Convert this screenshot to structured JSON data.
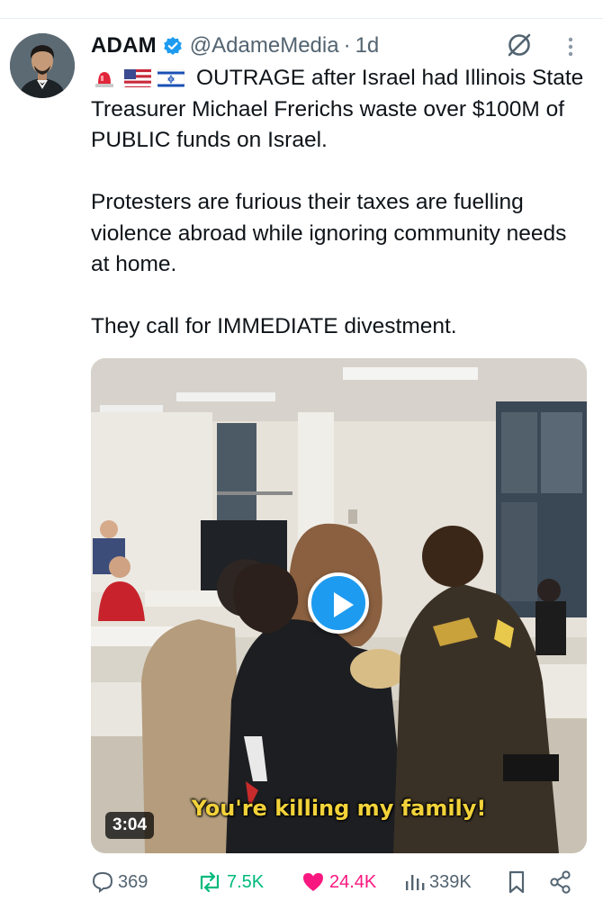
{
  "tweet": {
    "author_name": "ADAM",
    "handle": "@AdameMedia",
    "separator": "·",
    "time": "1d",
    "headline": "OUTRAGE after Israel had Illinois State Treasurer Michael Frerichs waste over $100M of PUBLIC funds on Israel.",
    "paragraph_2": "Protesters are furious their taxes are fuelling violence abroad while ignoring community needs at home.",
    "paragraph_3": "They call for IMMEDIATE divestment.",
    "flag_icons": [
      "siren-emoji-icon",
      "us-flag-icon",
      "israel-flag-icon"
    ]
  },
  "video": {
    "caption": "You're killing my family!",
    "duration": "3:04"
  },
  "actions": {
    "replies": "369",
    "reposts": "7.5K",
    "likes": "24.4K",
    "views": "339K"
  },
  "colors": {
    "accent": "#1d9bf0",
    "repost_green": "#00ba7c",
    "like_pink": "#f91880",
    "muted_text": "#536471",
    "caption_yellow": "#f2d23a"
  }
}
